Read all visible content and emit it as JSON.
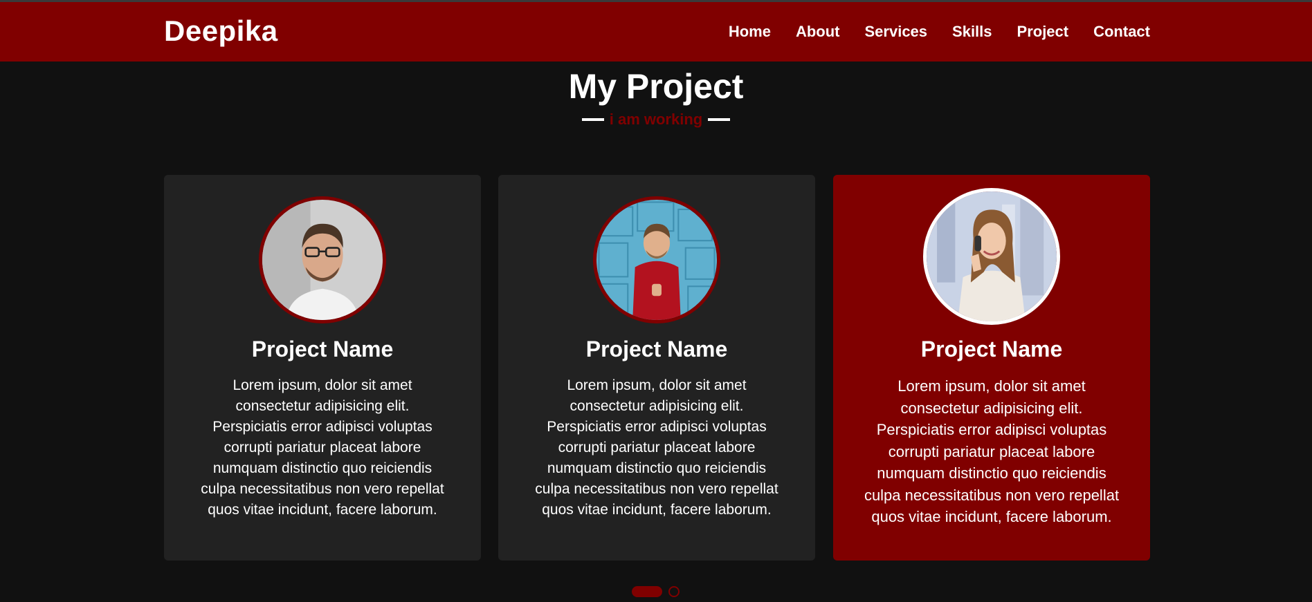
{
  "brand": "Deepika",
  "nav": [
    "Home",
    "About",
    "Services",
    "Skills",
    "Project",
    "Contact"
  ],
  "section": {
    "title": "My Project",
    "subtitle": "i am working"
  },
  "cards": [
    {
      "name": "Project Name",
      "description": "Lorem ipsum, dolor sit amet consectetur adipisicing elit. Perspiciatis error adipisci voluptas corrupti pariatur placeat labore numquam distinctio quo reiciendis culpa necessitatibus non vero repellat quos vitae incidunt, facere laborum."
    },
    {
      "name": "Project Name",
      "description": "Lorem ipsum, dolor sit amet consectetur adipisicing elit. Perspiciatis error adipisci voluptas corrupti pariatur placeat labore numquam distinctio quo reiciendis culpa necessitatibus non vero repellat quos vitae incidunt, facere laborum."
    },
    {
      "name": "Project Name",
      "description": "Lorem ipsum, dolor sit amet consectetur adipisicing elit. Perspiciatis error adipisci voluptas corrupti pariatur placeat labore numquam distinctio quo reiciendis culpa necessitatibus non vero repellat quos vitae incidunt, facere laborum."
    }
  ],
  "colors": {
    "accent": "#800000",
    "background": "#111111",
    "card": "#222222"
  }
}
